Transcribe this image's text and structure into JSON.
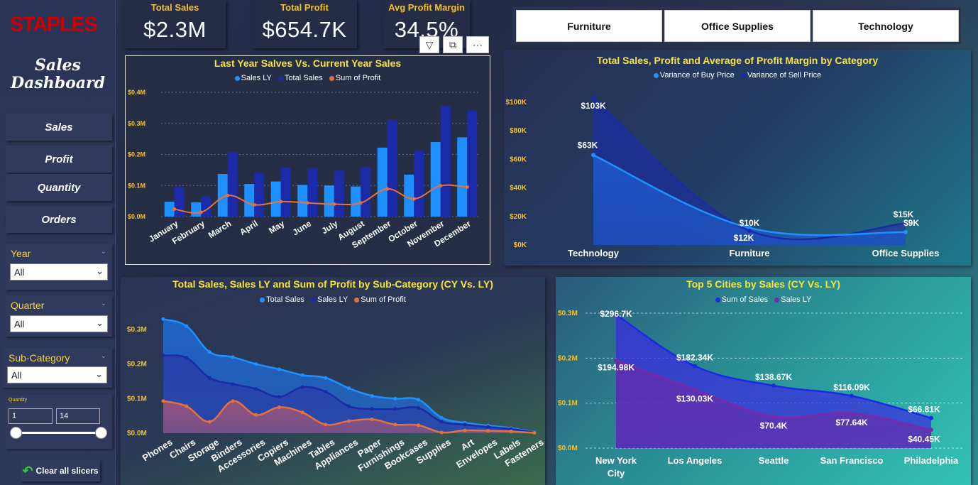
{
  "sidebar": {
    "logo": "STAPLES",
    "title_line1": "Sales",
    "title_line2": "Dashboard",
    "nav": [
      {
        "label": "Sales"
      },
      {
        "label": "Profit"
      },
      {
        "label": "Quantity"
      },
      {
        "label": "Orders"
      }
    ],
    "slicers": {
      "year": {
        "label": "Year",
        "value": "All"
      },
      "quarter": {
        "label": "Quarter",
        "value": "All"
      },
      "subcategory": {
        "label": "Sub-Category",
        "value": "All"
      },
      "quantity": {
        "label": "Quantity",
        "min": "1",
        "max": "14"
      }
    },
    "clear_label": "Clear all slicers"
  },
  "kpis": [
    {
      "label": "Total Sales",
      "value": "$2.3M"
    },
    {
      "label": "Total Profit",
      "value": "$654.7K"
    },
    {
      "label": "Avg Profit Margin",
      "value": "34.5%"
    }
  ],
  "category_buttons": [
    {
      "label": "Furniture"
    },
    {
      "label": "Office Supplies"
    },
    {
      "label": "Technology"
    }
  ],
  "colors": {
    "light_blue": "#1e90ff",
    "dark_blue": "#1a2aa8",
    "orange": "#e8703a",
    "yellow": "#f7e43a"
  },
  "chart_data": [
    {
      "type": "bar",
      "title": "Last Year Salves Vs. Current Year Sales",
      "categories": [
        "January",
        "February",
        "March",
        "April",
        "May",
        "June",
        "July",
        "August",
        "September",
        "October",
        "November",
        "December"
      ],
      "series": [
        {
          "name": "Sales LY",
          "values": [
            0.048,
            0.046,
            0.137,
            0.105,
            0.113,
            0.102,
            0.1,
            0.097,
            0.222,
            0.135,
            0.24,
            0.255
          ]
        },
        {
          "name": "Total Sales",
          "values": [
            0.095,
            0.065,
            0.207,
            0.14,
            0.158,
            0.156,
            0.148,
            0.16,
            0.311,
            0.212,
            0.356,
            0.342
          ]
        },
        {
          "name": "Sum of Profit",
          "values": [
            0.024,
            0.014,
            0.068,
            0.038,
            0.048,
            0.044,
            0.04,
            0.044,
            0.089,
            0.057,
            0.099,
            0.095
          ]
        }
      ],
      "y_ticks": [
        "$0.0M",
        "$0.1M",
        "$0.2M",
        "$0.3M",
        "$0.4M"
      ],
      "ylim": [
        0,
        0.4
      ]
    },
    {
      "type": "area",
      "title": "Total Sales, Profit and Average of Profit Margin by Category",
      "categories": [
        "Technology",
        "Furniture",
        "Office Supplies"
      ],
      "series": [
        {
          "name": "Variance of Buy Price",
          "values": [
            63,
            12,
            9
          ],
          "labels": [
            "$63K",
            "$12K",
            "$9K"
          ]
        },
        {
          "name": "Variance of Sell Price",
          "values": [
            103,
            10,
            15
          ],
          "labels": [
            "$103K",
            "$10K",
            "$15K"
          ]
        }
      ],
      "y_ticks": [
        "$0K",
        "$20K",
        "$40K",
        "$60K",
        "$80K",
        "$100K"
      ],
      "ylim": [
        0,
        100
      ]
    },
    {
      "type": "area",
      "title": "Total Sales, Sales LY and Sum of Profit by Sub-Category (CY Vs. LY)",
      "categories": [
        "Phones",
        "Chairs",
        "Storage",
        "Binders",
        "Accessories",
        "Copiers",
        "Machines",
        "Tables",
        "Appliances",
        "Paper",
        "Furnishings",
        "Bookcases",
        "Supplies",
        "Art",
        "Envelopes",
        "Labels",
        "Fasteners"
      ],
      "series": [
        {
          "name": "Total Sales",
          "values": [
            0.33,
            0.31,
            0.235,
            0.22,
            0.2,
            0.185,
            0.168,
            0.16,
            0.13,
            0.108,
            0.1,
            0.097,
            0.045,
            0.03,
            0.022,
            0.015,
            0.003
          ]
        },
        {
          "name": "Sales LY",
          "values": [
            0.225,
            0.218,
            0.16,
            0.142,
            0.128,
            0.105,
            0.133,
            0.12,
            0.078,
            0.07,
            0.07,
            0.073,
            0.033,
            0.025,
            0.018,
            0.012,
            0.002
          ]
        },
        {
          "name": "Sum of Profit",
          "values": [
            0.093,
            0.078,
            0.033,
            0.093,
            0.053,
            0.075,
            0.06,
            0.025,
            0.035,
            0.04,
            0.025,
            0.023,
            0.002,
            0.008,
            0.007,
            0.005,
            0.001
          ]
        }
      ],
      "y_ticks": [
        "$0.0M",
        "$0.1M",
        "$0.2M",
        "$0.3M"
      ],
      "ylim": [
        0,
        0.3
      ]
    },
    {
      "type": "area",
      "title": "Top 5 Cities by Sales (CY Vs. LY)",
      "categories": [
        "New York City",
        "Los Angeles",
        "Seattle",
        "San Francisco",
        "Philadelphia"
      ],
      "category_lines": [
        [
          "New York",
          "City"
        ],
        [
          "Los Angeles"
        ],
        [
          "Seattle"
        ],
        [
          "San Francisco"
        ],
        [
          "Philadelphia"
        ]
      ],
      "series": [
        {
          "name": "Sum of Sales",
          "values": [
            296.7,
            182.34,
            138.67,
            116.09,
            66.81
          ],
          "labels": [
            "$296.7K",
            "$182.34K",
            "$138.67K",
            "$116.09K",
            "$66.81K"
          ]
        },
        {
          "name": "Sales LY",
          "values": [
            194.98,
            130.03,
            70.4,
            77.64,
            40.45
          ],
          "labels": [
            "$194.98K",
            "$130.03K",
            "$70.4K",
            "$77.64K",
            "$40.45K"
          ]
        }
      ],
      "y_ticks": [
        "$0.0M",
        "$0.1M",
        "$0.2M",
        "$0.3M"
      ],
      "ylim": [
        0,
        300
      ]
    }
  ]
}
